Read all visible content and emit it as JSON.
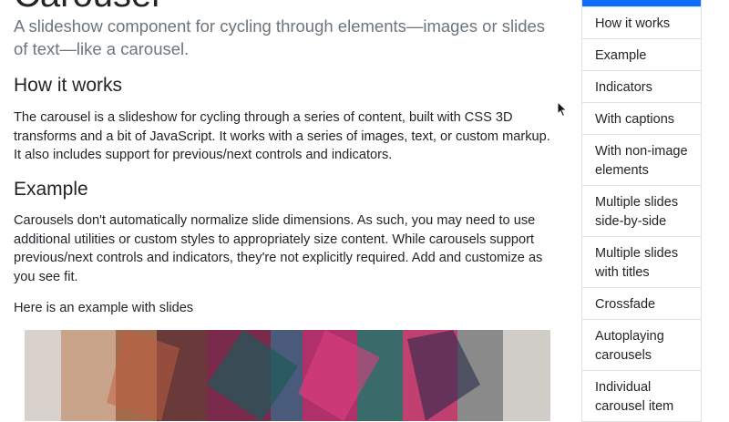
{
  "page": {
    "title": "Carousel",
    "lead": "A slideshow component for cycling through elements—images or slides of text—like a carousel."
  },
  "how_it_works": {
    "heading": "How it works",
    "text": "The carousel is a slideshow for cycling through a series of content, built with CSS 3D transforms and a bit of JavaScript. It works with a series of images, text, or custom markup. It also includes support for previous/next controls and indicators."
  },
  "example": {
    "heading": "Example",
    "text": "Carousels don't automatically normalize slide dimensions. As such, you may need to use additional utilities or custom styles to appropriately size content. While carousels support previous/next controls and indicators, they're not explicitly required. Add and customize as you see fit.",
    "slides_intro": "Here is an example with slides"
  },
  "sidebar": {
    "items": [
      {
        "label": ""
      },
      {
        "label": "How it works"
      },
      {
        "label": "Example"
      },
      {
        "label": "Indicators"
      },
      {
        "label": "With captions"
      },
      {
        "label": "With non-image elements"
      },
      {
        "label": "Multiple slides side-by-side"
      },
      {
        "label": "Multiple slides with titles"
      },
      {
        "label": "Crossfade"
      },
      {
        "label": "Autoplaying carousels"
      },
      {
        "label": "Individual carousel item"
      }
    ]
  },
  "colors": {
    "active": "#0d6efd",
    "text": "#212529",
    "muted": "#6c757d",
    "border": "#dee2e6"
  },
  "icons": {
    "cursor": "mouse-pointer-icon"
  }
}
